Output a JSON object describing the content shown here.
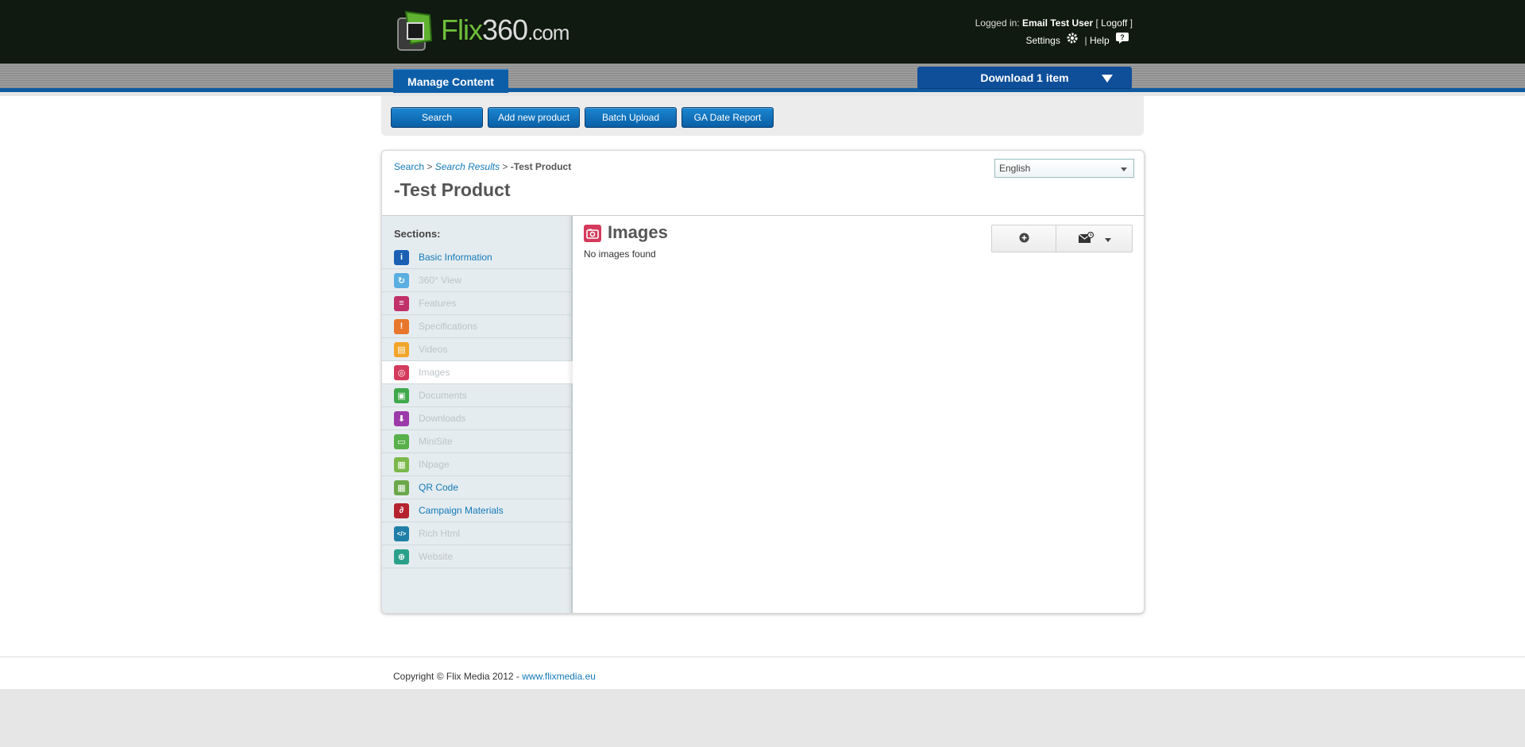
{
  "header": {
    "logo": {
      "word_flix": "Flix",
      "word_num": "360",
      "word_com": ".com"
    },
    "logged_in_label": "Logged in:",
    "user_name": "Email Test User",
    "logoff_label": "Logoff",
    "settings_label": "Settings",
    "help_label": "Help"
  },
  "nav": {
    "tab_manage": "Manage Content",
    "download_label": "Download 1 item"
  },
  "toolbar": {
    "buttons": [
      "Search",
      "Add new product",
      "Batch Upload",
      "GA Date Report"
    ]
  },
  "breadcrumb": {
    "search": "Search",
    "results": "Search Results",
    "current": "-Test Product"
  },
  "page_title": "-Test Product",
  "language": {
    "selected": "English"
  },
  "sidebar": {
    "label": "Sections:",
    "items": [
      {
        "label": "Basic Information",
        "state": "enabled",
        "icon": "info-icon",
        "color": "#1a5fb4",
        "glyph": "i"
      },
      {
        "label": "360° View",
        "state": "disabled",
        "icon": "rotate-icon",
        "color": "#5aaee0",
        "glyph": "↻"
      },
      {
        "label": "Features",
        "state": "disabled",
        "icon": "features-icon",
        "color": "#c0306a",
        "glyph": "≡"
      },
      {
        "label": "Specifications",
        "state": "disabled",
        "icon": "specs-icon",
        "color": "#e8762b",
        "glyph": "!"
      },
      {
        "label": "Videos",
        "state": "disabled",
        "icon": "film-icon",
        "color": "#f2a52a",
        "glyph": "▤"
      },
      {
        "label": "Images",
        "state": "active",
        "icon": "camera-icon",
        "color": "#d43a5c",
        "glyph": "◎"
      },
      {
        "label": "Documents",
        "state": "disabled",
        "icon": "document-icon",
        "color": "#3ea84a",
        "glyph": "▣"
      },
      {
        "label": "Downloads",
        "state": "disabled",
        "icon": "download-icon",
        "color": "#9b3aa8",
        "glyph": "⬇"
      },
      {
        "label": "MiniSite",
        "state": "disabled",
        "icon": "minisite-icon",
        "color": "#58b04a",
        "glyph": "▭"
      },
      {
        "label": "INpage",
        "state": "disabled",
        "icon": "inpage-icon",
        "color": "#7ab84a",
        "glyph": "▦"
      },
      {
        "label": "QR Code",
        "state": "enabled",
        "icon": "qr-icon",
        "color": "#6aa84a",
        "glyph": "▦"
      },
      {
        "label": "Campaign Materials",
        "state": "enabled",
        "icon": "paperclip-icon",
        "color": "#b5232f",
        "glyph": "∂"
      },
      {
        "label": "Rich Html",
        "state": "disabled",
        "icon": "code-icon",
        "color": "#1f7fa8",
        "glyph": "</>"
      },
      {
        "label": "Website",
        "state": "disabled",
        "icon": "globe-icon",
        "color": "#2aa08a",
        "glyph": "⊕"
      }
    ]
  },
  "main": {
    "title": "Images",
    "empty_text": "No images found"
  },
  "footer": {
    "copyright": "Copyright © Flix Media 2012 - ",
    "link": "www.flixmedia.eu"
  },
  "colors": {
    "header_bg": "#101a10",
    "brand_green": "#6fbf3b",
    "accent_blue": "#0d5ea8",
    "link": "#1279b8"
  }
}
